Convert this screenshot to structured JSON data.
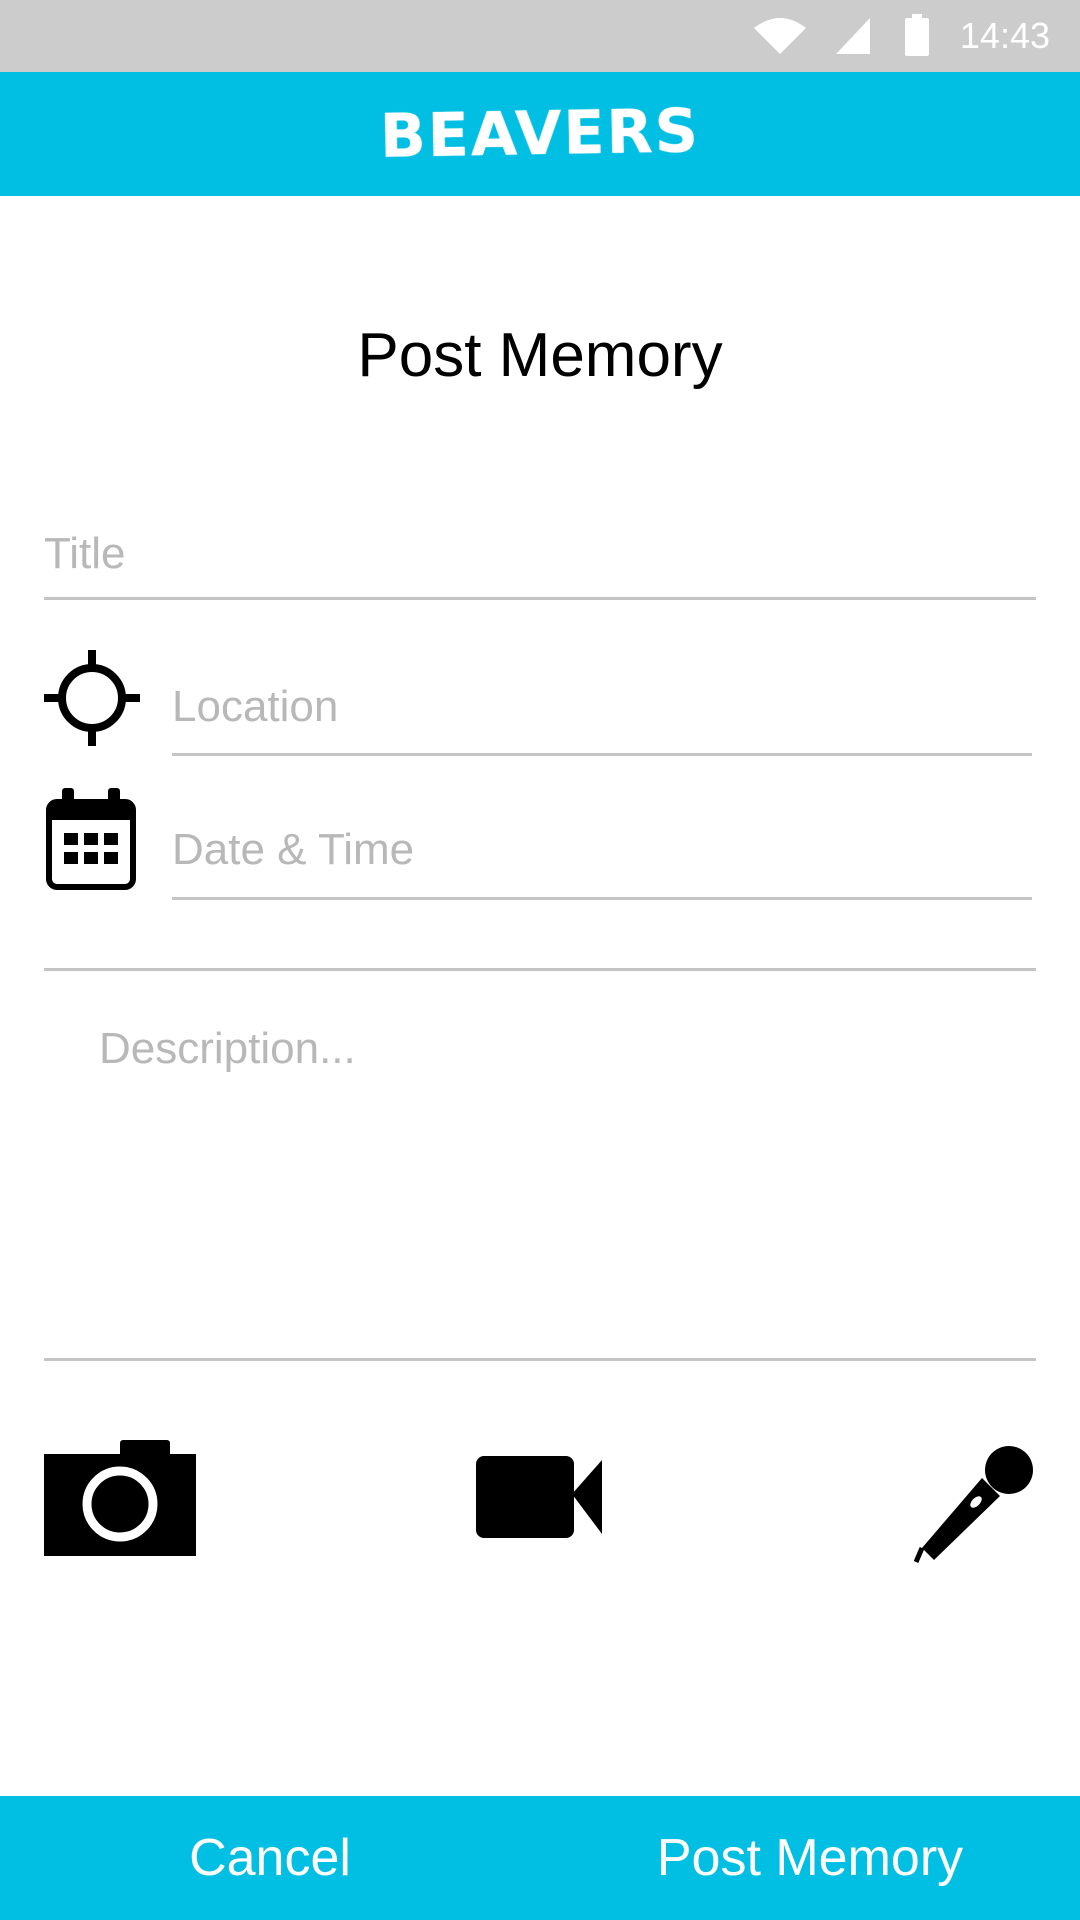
{
  "status_bar": {
    "time": "14:43",
    "icons": [
      "wifi-icon",
      "signal-icon",
      "battery-icon"
    ]
  },
  "app_bar": {
    "title": "BEAVERS",
    "color": "#00bfe3"
  },
  "page": {
    "title": "Post Memory"
  },
  "form": {
    "title_placeholder": "Title",
    "location_placeholder": "Location",
    "location_icon": "crosshair-icon",
    "datetime_placeholder": "Date & Time",
    "datetime_icon": "calendar-icon",
    "description_placeholder": "Description..."
  },
  "media": {
    "icons": [
      "camera-icon",
      "video-camera-icon",
      "microphone-icon"
    ]
  },
  "bottom_bar": {
    "cancel_label": "Cancel",
    "post_label": "Post Memory"
  }
}
